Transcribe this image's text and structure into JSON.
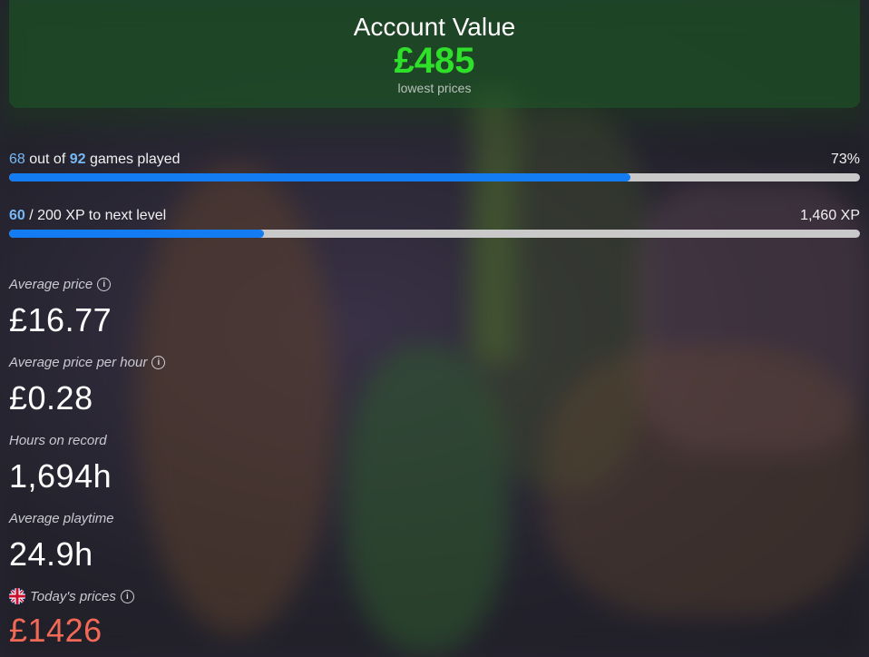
{
  "account": {
    "title": "Account Value",
    "value": "£485",
    "subtitle": "lowest prices"
  },
  "games": {
    "played": "68",
    "out_of": " out of ",
    "total": "92",
    "suffix": " games played",
    "percent_label": "73%",
    "progress": 0.73
  },
  "xp": {
    "current": "60",
    "suffix": " / 200 XP to next level",
    "total_label": "1,460 XP",
    "progress": 0.3
  },
  "stats": {
    "avg_price": {
      "label": "Average price",
      "value": "£16.77",
      "icon": "info-icon"
    },
    "avg_price_hour": {
      "label": "Average price per hour",
      "value": "£0.28",
      "icon": "info-icon"
    },
    "hours": {
      "label": "Hours on record",
      "value": "1,694h"
    },
    "avg_playtime": {
      "label": "Average playtime",
      "value": "24.9h"
    },
    "todays_prices": {
      "label": "Today's prices",
      "value": "£1426",
      "icon": "uk-flag-icon"
    }
  },
  "colors": {
    "accent": "#137cf2",
    "value_green": "#2fe02a",
    "highlight_blue": "#78b8f5",
    "price_red": "#f26a55"
  }
}
